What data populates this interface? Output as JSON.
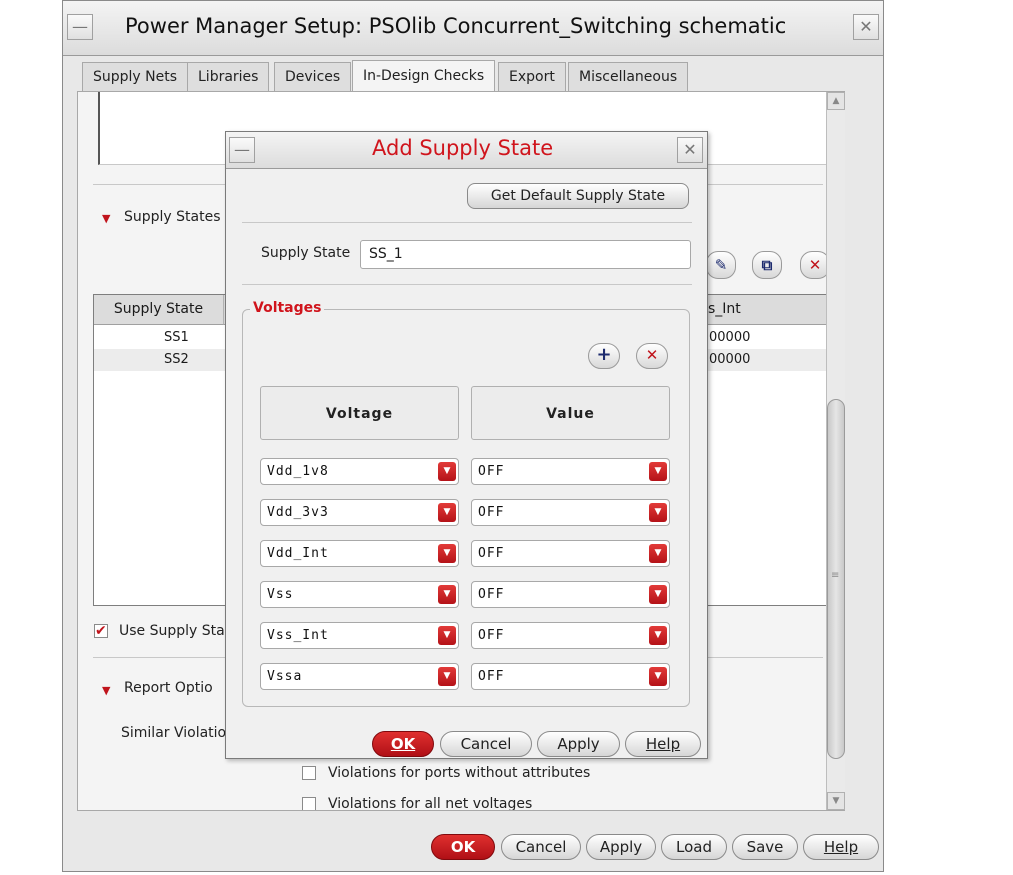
{
  "main_window": {
    "title": "Power Manager Setup: PSOlib Concurrent_Switching schematic",
    "minimize_glyph": "—",
    "close_glyph": "✕",
    "tabs": [
      {
        "label": "Supply Nets",
        "active": false
      },
      {
        "label": "Libraries",
        "active": false
      },
      {
        "label": "Devices",
        "active": false
      },
      {
        "label": "In-Design Checks",
        "active": true
      },
      {
        "label": "Export",
        "active": false
      },
      {
        "label": "Miscellaneous",
        "active": false
      }
    ],
    "supply_states_section": {
      "caret": "▼",
      "label": "Supply States"
    },
    "toolbar_icons": {
      "edit": "✎",
      "copy": "⧉",
      "delete": "✕"
    },
    "table": {
      "headers": [
        "Supply State",
        "s_Int"
      ],
      "rows": [
        {
          "state": "SS1",
          "value": "00000"
        },
        {
          "state": "SS2",
          "value": "00000"
        }
      ]
    },
    "use_supply_states": {
      "label": "Use Supply Sta",
      "checked": true,
      "check_glyph": "✔"
    },
    "report_options_section": {
      "caret": "▼",
      "label": "Report Optio"
    },
    "similar_violations_label": "Similar Violatio",
    "checkboxes": [
      {
        "label": "Violations for ports without attributes",
        "checked": false
      },
      {
        "label": "Violations for all net voltages",
        "checked": false
      }
    ],
    "buttons": {
      "ok": "OK",
      "cancel": "Cancel",
      "apply": "Apply",
      "load": "Load",
      "save": "Save",
      "help": "Help"
    },
    "scroll_grip": "≡"
  },
  "dialog": {
    "title": "Add Supply State",
    "minimize_glyph": "—",
    "close_glyph": "✕",
    "default_button": "Get Default Supply State",
    "supply_state_label": "Supply State",
    "supply_state_value": "SS_1",
    "voltages_group_label": "Voltages",
    "add_glyph": "+",
    "remove_glyph": "✕",
    "column_headers": {
      "voltage": "Voltage",
      "value": "Value"
    },
    "dropdown_arrow": "▼",
    "rows": [
      {
        "voltage": "Vdd_1v8",
        "value": "OFF"
      },
      {
        "voltage": "Vdd_3v3",
        "value": "OFF"
      },
      {
        "voltage": "Vdd_Int",
        "value": "OFF"
      },
      {
        "voltage": "Vss",
        "value": "OFF"
      },
      {
        "voltage": "Vss_Int",
        "value": "OFF"
      },
      {
        "voltage": "Vssa",
        "value": "OFF"
      }
    ],
    "buttons": {
      "ok": "OK",
      "cancel": "Cancel",
      "apply": "Apply",
      "help": "Help"
    }
  },
  "colors": {
    "accent_red": "#d0141c",
    "button_red": "#b01016"
  }
}
